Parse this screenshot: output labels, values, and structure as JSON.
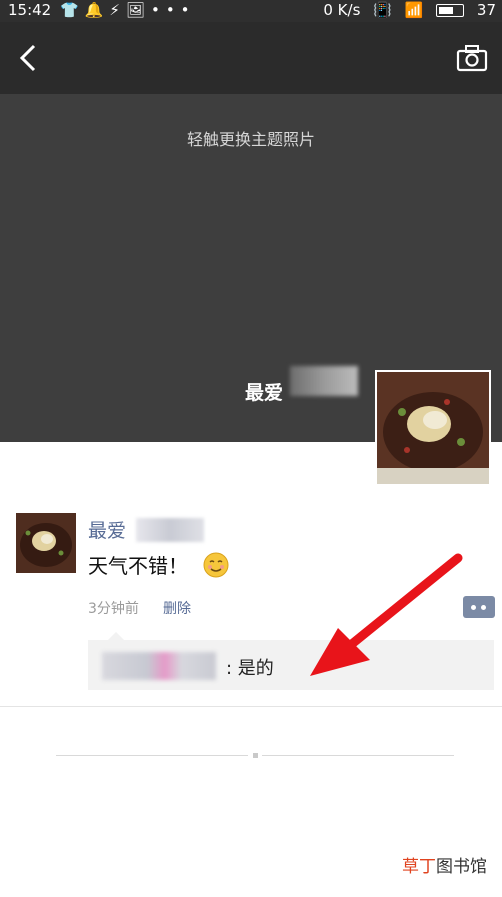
{
  "status_bar": {
    "time": "15:42",
    "left_icons": [
      "shirt-icon",
      "notification-icon",
      "bolt-icon",
      "image-icon",
      "more-dots-icon"
    ],
    "more_dots": "•••",
    "net_speed": "0 K/s",
    "battery": "37"
  },
  "cover": {
    "hint": "轻触更换主题照片",
    "username": "最爱"
  },
  "post": {
    "name": "最爱",
    "text": "天气不错！",
    "time": "3分钟前",
    "delete_label": "删除",
    "comment": ": 是的"
  },
  "watermark": {
    "accent": "草丁",
    "rest": "图书馆"
  },
  "colors": {
    "link_blue": "#576b95",
    "arrow_red": "#e8141a",
    "cover_dark": "#3e3e3e"
  }
}
